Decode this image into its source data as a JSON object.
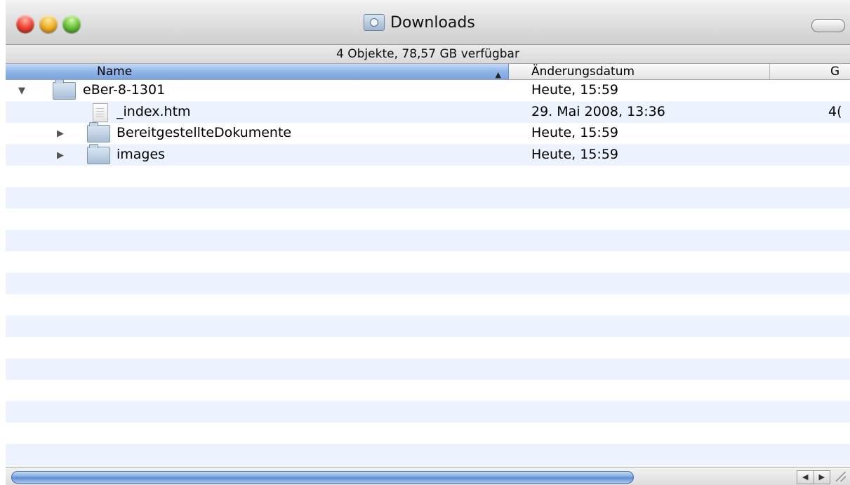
{
  "window": {
    "title": "Downloads",
    "status": "4 Objekte, 78,57 GB verfügbar"
  },
  "columns": {
    "name": "Name",
    "date": "Änderungsdatum",
    "size": "G"
  },
  "rows": [
    {
      "name": "eBer-8-1301",
      "date": "Heute, 15:59",
      "size": "",
      "kind": "folder",
      "disclosure": "expanded",
      "icon": "folder-icon"
    },
    {
      "name": "_index.htm",
      "date": "29. Mai 2008, 13:36",
      "size": "4(",
      "kind": "file",
      "disclosure": "none",
      "icon": "document-icon"
    },
    {
      "name": "BereitgestellteDokumente",
      "date": "Heute, 15:59",
      "size": "",
      "kind": "folder",
      "disclosure": "collapsed",
      "icon": "folder-icon"
    },
    {
      "name": "images",
      "date": "Heute, 15:59",
      "size": "",
      "kind": "folder",
      "disclosure": "collapsed",
      "icon": "folder-icon"
    }
  ],
  "colors": {
    "header_selected": "#8fb5e8",
    "row_stripe": "#edf3fe",
    "scroll_thumb": "#5d8ed4"
  }
}
